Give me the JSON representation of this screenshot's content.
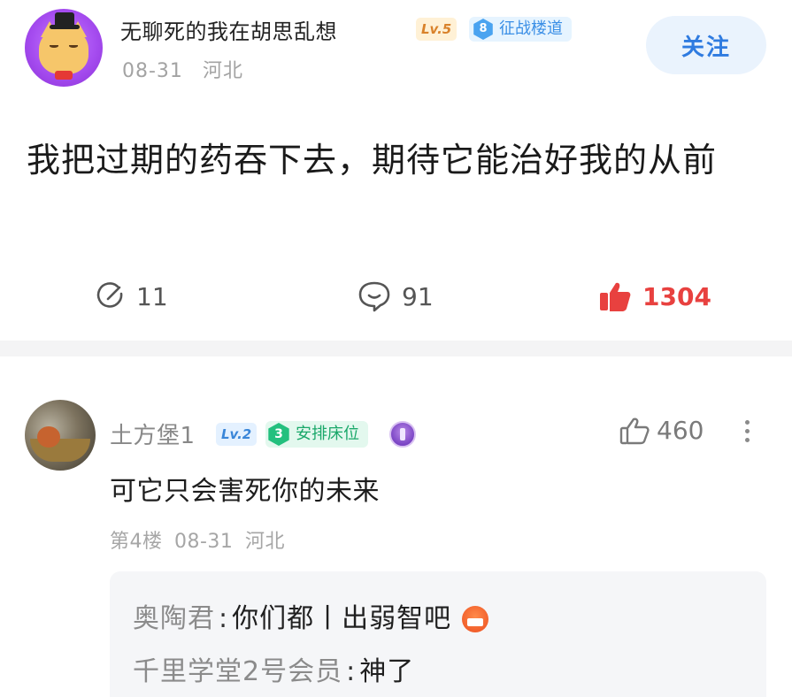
{
  "post": {
    "username": "无聊死的我在胡思乱想",
    "level_badge": "Lv.5",
    "floor_badge_num": "8",
    "floor_badge_text": "征战楼道",
    "date": "08-31",
    "location": "河北",
    "follow_label": "关注",
    "text": "我把过期的药吞下去，期待它能治好我的从前",
    "share_count": "11",
    "comment_count": "91",
    "like_count": "1304"
  },
  "comment": {
    "username": "土方堡1",
    "level_badge": "Lv.2",
    "floor_badge_num": "3",
    "floor_badge_text": "安排床位",
    "like_count": "460",
    "text": "可它只会害死你的未来",
    "floor": "第4楼",
    "date": "08-31",
    "location": "河北",
    "replies": [
      {
        "author": "奥陶君",
        "text": "你们都丨出弱智吧"
      },
      {
        "author": "千里学堂2号会员",
        "text": "神了"
      }
    ]
  },
  "colors": {
    "accent_blue": "#2f7be0",
    "like_red": "#e8413f",
    "meta_gray": "#a3a3a3"
  }
}
